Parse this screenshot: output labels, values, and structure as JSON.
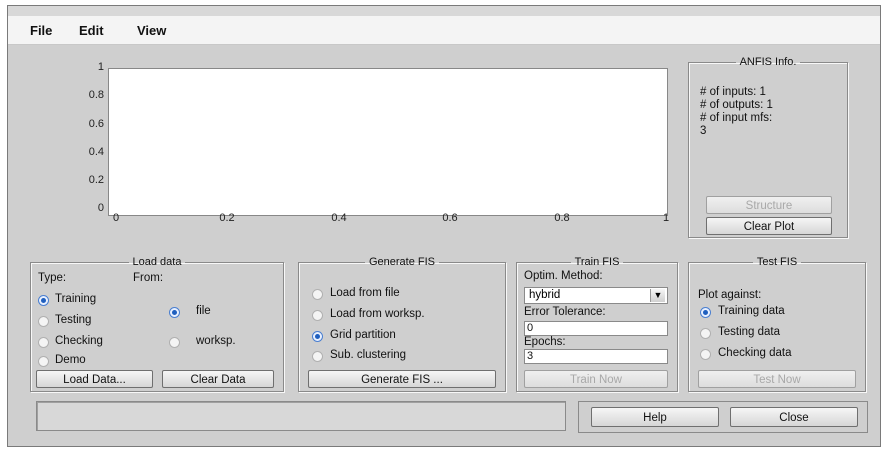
{
  "menu": {
    "file": "File",
    "edit": "Edit",
    "view": "View"
  },
  "plot": {
    "yticks": [
      "1",
      "0.8",
      "0.6",
      "0.4",
      "0.2",
      "0"
    ],
    "xticks": [
      "0",
      "0.2",
      "0.4",
      "0.6",
      "0.8",
      "1"
    ]
  },
  "anfis_info": {
    "title": "ANFIS Info.",
    "inputs": "# of inputs: 1",
    "outputs": "# of outputs: 1",
    "mfs_label": "# of input mfs:",
    "mfs_value": "3",
    "structure_btn": "Structure",
    "clear_plot_btn": "Clear Plot"
  },
  "load_data": {
    "title": "Load data",
    "type_label": "Type:",
    "from_label": "From:",
    "types": [
      "Training",
      "Testing",
      "Checking",
      "Demo"
    ],
    "selected_type": "Training",
    "sources": [
      "file",
      "worksp."
    ],
    "selected_source": "file",
    "load_btn": "Load Data...",
    "clear_btn": "Clear Data"
  },
  "generate_fis": {
    "title": "Generate FIS",
    "options": [
      "Load from file",
      "Load from worksp.",
      "Grid partition",
      "Sub. clustering"
    ],
    "selected": "Grid partition",
    "button": "Generate FIS ..."
  },
  "train_fis": {
    "title": "Train FIS",
    "method_label": "Optim. Method:",
    "method_value": "hybrid",
    "tolerance_label": "Error Tolerance:",
    "tolerance_value": "0",
    "epochs_label": "Epochs:",
    "epochs_value": "3",
    "button": "Train Now"
  },
  "test_fis": {
    "title": "Test FIS",
    "plot_against": "Plot against:",
    "options": [
      "Training data",
      "Testing data",
      "Checking data"
    ],
    "selected": "Training data",
    "button": "Test Now"
  },
  "bottom": {
    "help": "Help",
    "close": "Close",
    "status": ""
  },
  "colors": {
    "window_bg": "#cfcfcf",
    "radio_selected": "#1f5fbf",
    "disabled_text": "#a8a8a8"
  }
}
